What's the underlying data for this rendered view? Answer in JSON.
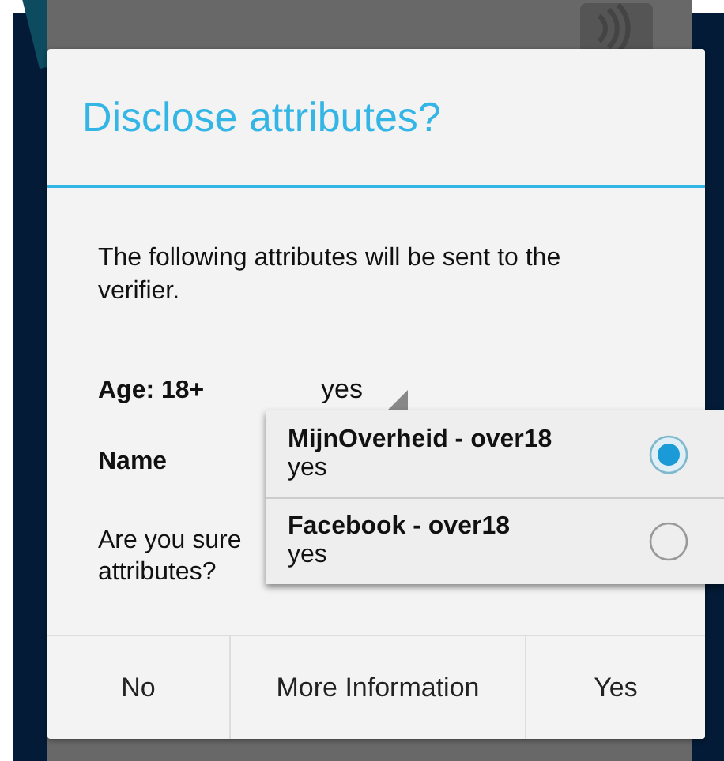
{
  "dialog": {
    "title": "Disclose attributes?",
    "message": "The following attributes will be sent to the verifier.",
    "attributes": [
      {
        "label": "Age: 18+",
        "value": "yes"
      },
      {
        "label": "Name"
      }
    ],
    "question_lines": [
      "Are you sure",
      "attributes?"
    ],
    "buttons": [
      "No",
      "More Information",
      "Yes"
    ]
  },
  "dropdown": {
    "options": [
      {
        "title": "MijnOverheid - over18",
        "value": "yes",
        "selected": true
      },
      {
        "title": "Facebook - over18",
        "value": "yes",
        "selected": false
      }
    ]
  }
}
